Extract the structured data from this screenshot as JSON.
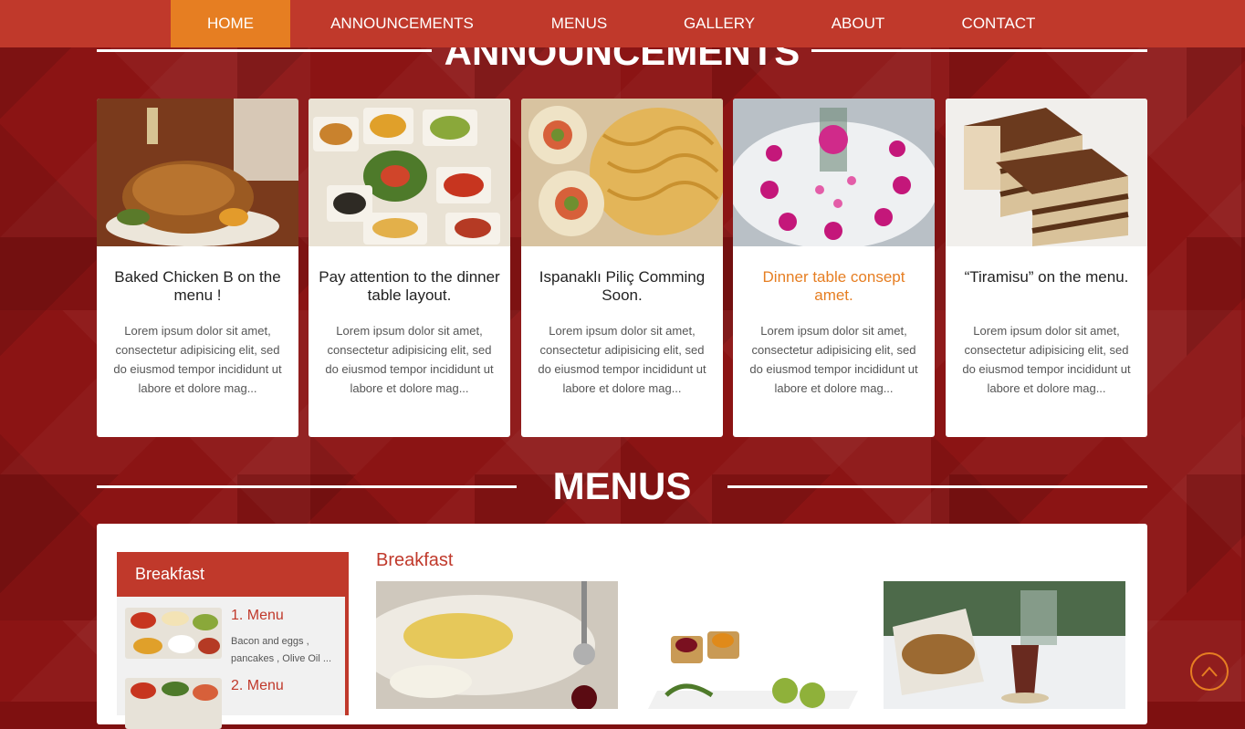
{
  "nav": {
    "items": [
      {
        "label": "HOME",
        "active": true
      },
      {
        "label": "ANNOUNCEMENTS",
        "active": false
      },
      {
        "label": "MENUS",
        "active": false
      },
      {
        "label": "GALLERY",
        "active": false
      },
      {
        "label": "ABOUT",
        "active": false
      },
      {
        "label": "CONTACT",
        "active": false
      }
    ]
  },
  "announcements": {
    "title": "ANNOUNCEMENTS",
    "cards": [
      {
        "title": "Baked Chicken B on the menu !",
        "text": "Lorem ipsum dolor sit amet, consectetur adipisicing elit, sed do eiusmod tempor incididunt ut labore et dolore mag...",
        "image": "roast-chicken-photo"
      },
      {
        "title": "Pay attention to the dinner table layout.",
        "text": "Lorem ipsum dolor sit amet, consectetur adipisicing elit, sed do eiusmod tempor incididunt ut labore et dolore mag...",
        "image": "meze-table-photo"
      },
      {
        "title": "Ispanaklı Piliç Comming Soon.",
        "text": "Lorem ipsum dolor sit amet, consectetur adipisicing elit, sed do eiusmod tempor incididunt ut labore et dolore mag...",
        "image": "pasta-rolls-photo"
      },
      {
        "title": "Dinner table consept amet.",
        "text": "Lorem ipsum dolor sit amet, consectetur adipisicing elit, sed do eiusmod tempor incididunt ut labore et dolore mag...",
        "image": "dinner-table-photo",
        "highlight": true
      },
      {
        "title": "“Tiramisu” on the menu.",
        "text": "Lorem ipsum dolor sit amet, consectetur adipisicing elit, sed do eiusmod tempor incididunt ut labore et dolore mag...",
        "image": "tiramisu-photo"
      }
    ]
  },
  "menus": {
    "title": "MENUS",
    "active_tab": "Breakfast",
    "heading": "Breakfast",
    "items": [
      {
        "name": "1. Menu",
        "desc": "Bacon and eggs , pancakes , Olive Oil ..."
      },
      {
        "name": "2. Menu",
        "desc": ""
      }
    ]
  },
  "colors": {
    "nav_bg": "#c0392b",
    "nav_active": "#e67e22",
    "page_bg": "#8b1414",
    "highlight": "#e67e22"
  },
  "scroll_top": {
    "icon": "chevron-up-icon"
  }
}
